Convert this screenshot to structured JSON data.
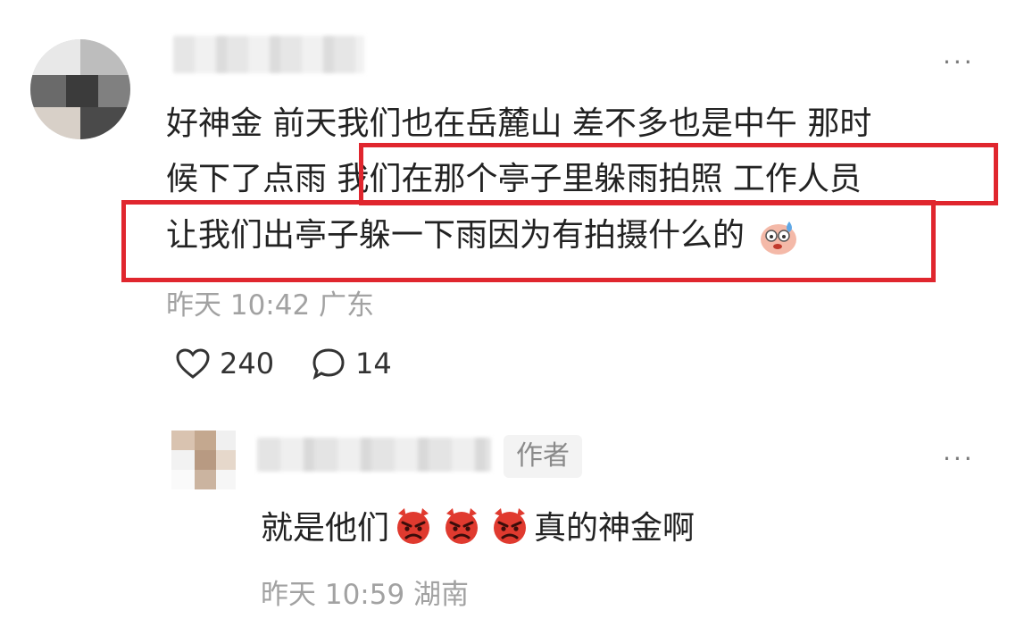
{
  "comment": {
    "more_label": "···",
    "lines": [
      "好神金  前天我们也在岳麓山  差不多也是中午  那时",
      "候下了点雨  我们在那个亭子里躲雨拍照  工作人员",
      "让我们出亭子躲一下雨因为有拍摄什么的"
    ],
    "line2_prefix": "候下了点雨 ",
    "line2_highlight": "我们在那个亭子里躲雨拍照  工作人员",
    "meta": "昨天 10:42 广东",
    "likes": "240",
    "replies": "14",
    "trailing_emoji": "sweat-face-emoji"
  },
  "reply": {
    "author_badge": "作者",
    "more_label": "···",
    "text_before": "就是他们",
    "emoji_icon": "angry-devil-emoji",
    "emoji_count": 3,
    "text_after": "真的神金啊",
    "meta": "昨天 10:59 湖南"
  },
  "colors": {
    "highlight_border": "#e0262e",
    "meta_text": "#a2a2a2",
    "emoji_red": "#e03a2f"
  }
}
